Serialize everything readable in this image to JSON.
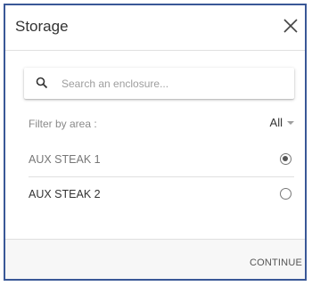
{
  "dialog": {
    "title": "Storage",
    "close_icon": "close-icon"
  },
  "search": {
    "icon": "search-icon",
    "placeholder": "Search an enclosure..."
  },
  "filter": {
    "label": "Filter by area :",
    "selected": "All"
  },
  "enclosures": [
    {
      "label": "AUX STEAK 1",
      "selected": true
    },
    {
      "label": "AUX STEAK 2",
      "selected": false
    }
  ],
  "footer": {
    "continue_label": "CONTINUE"
  },
  "colors": {
    "border_accent": "#3a5897",
    "footer_bg": "#f7f7f7"
  }
}
